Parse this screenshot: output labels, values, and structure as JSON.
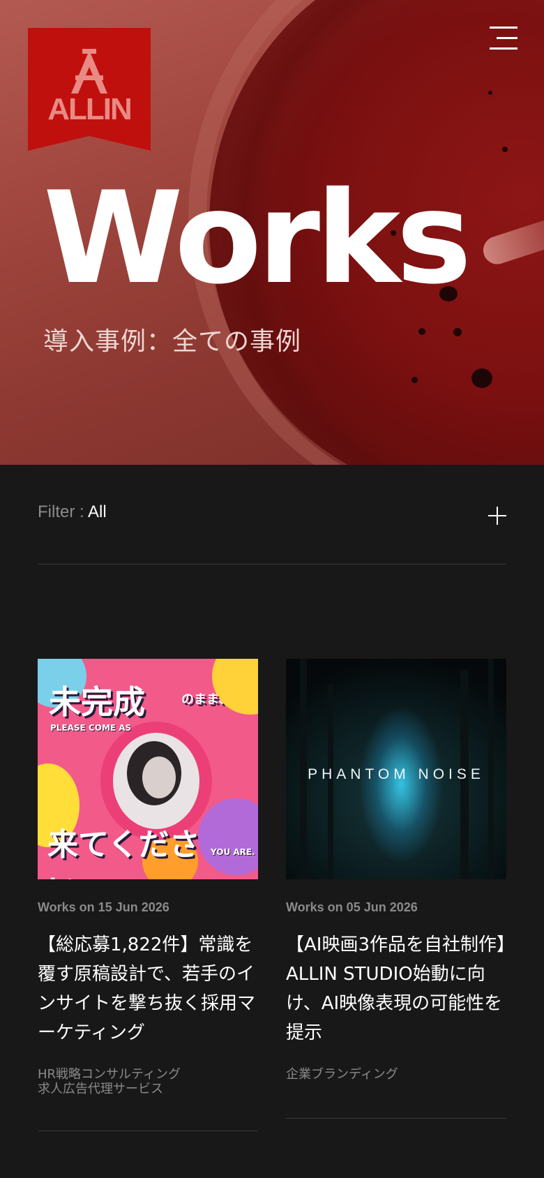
{
  "brand": {
    "logo_text": "ALLIN"
  },
  "hero": {
    "title": "Works",
    "subtitle": "導入事例：全ての事例"
  },
  "filter": {
    "label": "Filter : ",
    "value": "All"
  },
  "cards": [
    {
      "meta": "Works on 15 Jun 2026",
      "title": "【総応募1,822件】常識を覆す原稿設計で、若手のインサイトを撃ち抜く採用マーケティング",
      "tags": [
        "HR戦略コンサルティング",
        "求人広告代理サービス"
      ],
      "image_text": {
        "line1": "未完成",
        "line1_small": "のまま、",
        "line2_en": "PLEASE COME AS",
        "line3": "来てください。",
        "line3_en": "YOU ARE."
      }
    },
    {
      "meta": "Works on 05 Jun 2026",
      "title": "【AI映画3作品を自社制作】ALLIN STUDIO始動に向け、AI映像表現の可能性を提示",
      "tags": [
        "企業ブランディング"
      ],
      "image_text": {
        "title": "PHANTOM NOISE"
      }
    }
  ]
}
